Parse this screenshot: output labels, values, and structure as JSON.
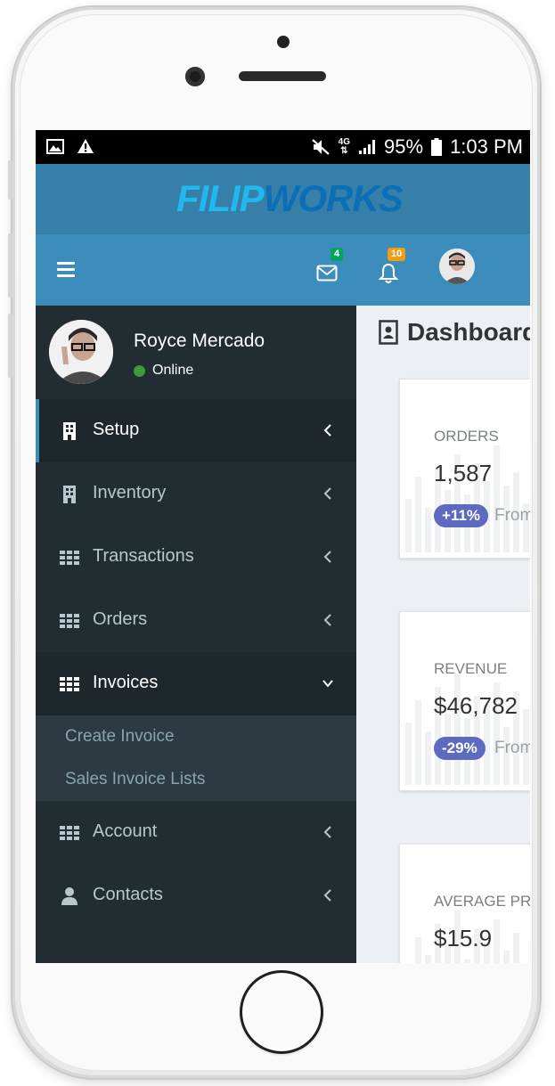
{
  "status_bar": {
    "battery": "95%",
    "time": "1:03 PM",
    "network": "4G"
  },
  "brand": {
    "part1": "FILIP",
    "part2": "WORKS"
  },
  "navbar": {
    "mail_badge": "4",
    "notifications_badge": "10"
  },
  "user": {
    "name": "Royce Mercado",
    "status": "Online"
  },
  "sidebar": {
    "items": [
      {
        "label": "Setup",
        "icon": "building-icon"
      },
      {
        "label": "Inventory",
        "icon": "building-icon"
      },
      {
        "label": "Transactions",
        "icon": "grid-icon"
      },
      {
        "label": "Orders",
        "icon": "grid-icon"
      },
      {
        "label": "Invoices",
        "icon": "grid-icon"
      },
      {
        "label": "Account",
        "icon": "grid-icon"
      },
      {
        "label": "Contacts",
        "icon": "user-icon"
      }
    ],
    "invoices_submenu": [
      "Create Invoice",
      "Sales Invoice Lists"
    ]
  },
  "content": {
    "title": "Dashboard",
    "cards": [
      {
        "label": "ORDERS",
        "value": "1,587",
        "change": "+11%",
        "from": "From"
      },
      {
        "label": "REVENUE",
        "value": "$46,782",
        "change": "-29%",
        "from": "From"
      },
      {
        "label": "AVERAGE PRICE",
        "value": "$15.9"
      }
    ]
  },
  "colors": {
    "header": "#3c8dbc",
    "logo_bar": "#367fa9",
    "sidebar": "#222d32",
    "pill": "#5c6bc0"
  }
}
